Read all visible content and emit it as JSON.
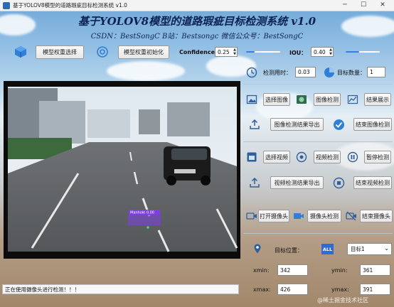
{
  "window": {
    "title": "基于YOLOV8模型的道路瑕疵目标检测系统 v1.0",
    "app_badge": "YOLOv8 检测系统"
  },
  "header": {
    "title": "基于YOLOV8模型的道路瑕疵目标检测系统 v1.0",
    "subtitle": "CSDN：BestSongC   B站：Bestsongc   微信公众号：BestSongC"
  },
  "model": {
    "select_label": "模型权重选择",
    "init_label": "模型权重初始化",
    "confidence_label": "Confidence:",
    "confidence_value": "0.25",
    "confidence_level": 0.25,
    "iou_label": "IOU：",
    "iou_value": "0.40",
    "iou_level": 0.4
  },
  "stats": {
    "time_label": "检测用时：",
    "time_value": "0.03",
    "count_label": "目标数量：",
    "count_value": "1"
  },
  "image_ops": {
    "select_image": "选择图像",
    "detect_image": "图像检测",
    "show_result": "结果展示",
    "export_image_result": "图像检测结果导出",
    "end_image_detect": "结束图像检测"
  },
  "video_ops": {
    "select_video": "选择视频",
    "detect_video": "视频检测",
    "pause_detect": "暂停检测",
    "export_video_result": "视频检测结果导出",
    "end_video_detect": "结束视频检测"
  },
  "camera_ops": {
    "open_camera": "打开摄像头",
    "camera_detect": "摄像头检测",
    "close_camera": "结束摄像头"
  },
  "target": {
    "position_label": "目标位置：",
    "all_badge": "ALL",
    "selected": "目标1",
    "xmin_label": "xmin:",
    "xmin": "342",
    "ymin_label": "ymin:",
    "ymin": "361",
    "xmax_label": "xmax:",
    "xmax": "426",
    "ymax_label": "ymax:",
    "ymax": "391"
  },
  "detection": {
    "label": "Manhole 0.00"
  },
  "status": {
    "text": "正在使用摄像头进行检测！！！"
  },
  "watermark": "@稀土掘金技术社区",
  "colors": {
    "accent": "#3b7ddd",
    "title": "#0b2255",
    "box": "#7b3fe4"
  }
}
